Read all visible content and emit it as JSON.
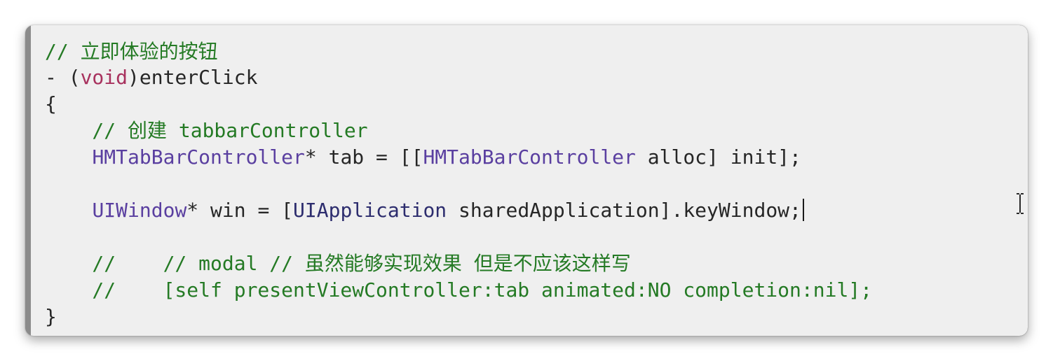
{
  "code": {
    "line1_comment": "// 立即体验的按钮",
    "line2_dash": "- (",
    "line2_void": "void",
    "line2_rest": ")enterClick",
    "line3_brace": "{",
    "line4_comment": "    // 创建 tabbarController",
    "line5_indent": "    ",
    "line5_type": "HMTabBarController",
    "line5_var": "* tab = [[",
    "line5_type2": "HMTabBarController",
    "line5_rest": " alloc] init];",
    "line6_blank": "",
    "line7_indent": "    ",
    "line7_type": "UIWindow",
    "line7_var": "* win = [",
    "line7_class": "UIApplication",
    "line7_rest": " sharedApplication].keyWindow;",
    "line8_blank": "",
    "line9_comment": "    //    // modal // 虽然能够实现效果 但是不应该这样写",
    "line10_comment": "    //    [self presentViewController:tab animated:NO completion:nil];",
    "line11_brace": "}"
  },
  "colors": {
    "comment": "#247a24",
    "keyword": "#a8325e",
    "type": "#5a3fa0",
    "text": "#262626",
    "background": "#efefef"
  },
  "icons": {
    "cursor": "ibeam-cursor-icon"
  }
}
